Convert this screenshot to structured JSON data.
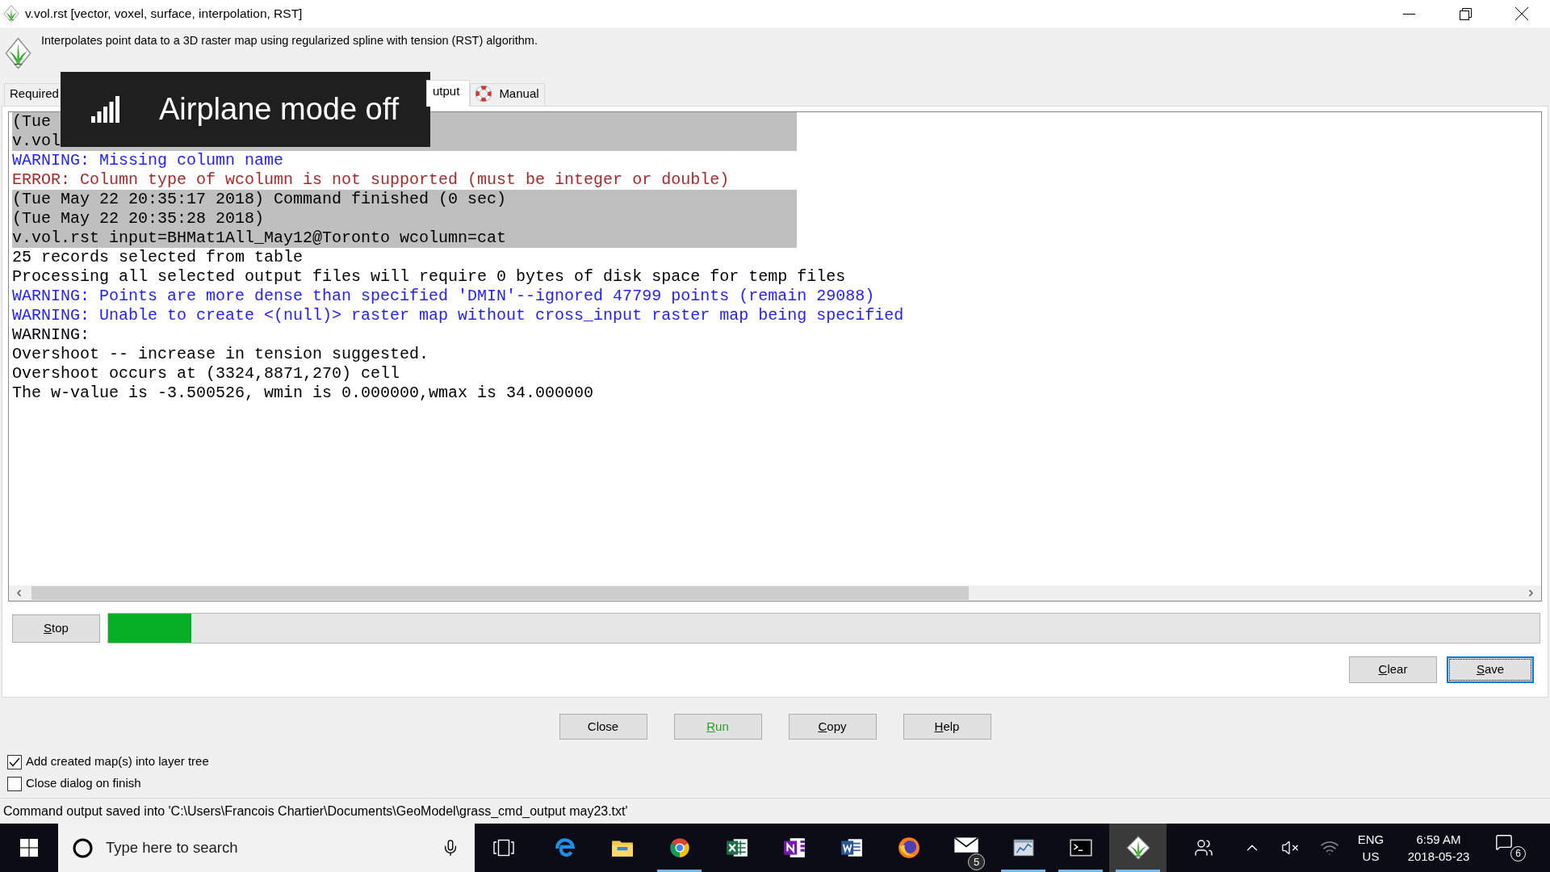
{
  "window": {
    "title": "v.vol.rst [vector, voxel, surface, interpolation, RST]"
  },
  "description": "Interpolates point data to a 3D raster map using regularized spline with tension (RST) algorithm.",
  "tabs": [
    {
      "label": "Required",
      "selected": false,
      "kind": "page"
    },
    {
      "label": "utput",
      "selected": true,
      "kind": "page"
    },
    {
      "label": "Manual",
      "selected": false,
      "kind": "manual"
    }
  ],
  "console": {
    "lines": [
      {
        "text": "(Tue",
        "kind": "command"
      },
      {
        "text": "v.vol",
        "kind": "command"
      },
      {
        "text": "WARNING: Missing column name",
        "kind": "warning"
      },
      {
        "text": "ERROR: Column type of wcolumn is not supported (must be integer or double)",
        "kind": "error"
      },
      {
        "text": "(Tue May 22 20:35:17 2018) Command finished (0 sec)",
        "kind": "command"
      },
      {
        "text": "(Tue May 22 20:35:28 2018)",
        "kind": "command"
      },
      {
        "text": "v.vol.rst input=BHMat1All_May12@Toronto wcolumn=cat",
        "kind": "command"
      },
      {
        "text": "25 records selected from table",
        "kind": "message"
      },
      {
        "text": "Processing all selected output files will require 0 bytes of disk space for temp files",
        "kind": "message"
      },
      {
        "text": "WARNING: Points are more dense than specified 'DMIN'--ignored 47799 points (remain 29088)",
        "kind": "warning"
      },
      {
        "text": "WARNING: Unable to create <(null)> raster map without cross_input raster map being specified",
        "kind": "warning"
      },
      {
        "text": "WARNING:",
        "kind": "message"
      },
      {
        "text": "Overshoot -- increase in tension suggested.",
        "kind": "message"
      },
      {
        "text": "Overshoot occurs at (3324,8871,270) cell",
        "kind": "message"
      },
      {
        "text": "The w-value is -3.500526, wmin is 0.000000,wmax is 34.000000",
        "kind": "message"
      }
    ]
  },
  "stop_button": {
    "label": "Stop",
    "mnemonic": true
  },
  "progress": {
    "level": 0.058
  },
  "console_buttons": [
    {
      "label": "Clear",
      "mnemonic": true,
      "focused": false
    },
    {
      "label": "Save",
      "mnemonic": true,
      "focused": true
    }
  ],
  "buttons": [
    {
      "label": "Close",
      "mnemonic": false,
      "kind": "plain"
    },
    {
      "label": "Run",
      "mnemonic": true,
      "kind": "run"
    },
    {
      "label": "Copy",
      "mnemonic": true,
      "kind": "plain"
    },
    {
      "label": "Help",
      "mnemonic": true,
      "kind": "plain"
    }
  ],
  "options": [
    {
      "label": "Add created map(s) into layer tree",
      "checked": true
    },
    {
      "label": "Close dialog on finish",
      "checked": false
    }
  ],
  "status_bar": "Command output saved into 'C:\\Users\\Francois Chartier\\Documents\\GeoModel\\grass_cmd_output may23.txt'",
  "notification": {
    "message": "Airplane mode off"
  },
  "taskbar": {
    "search": {
      "placeholder": "Type here to search"
    },
    "apps": [
      {
        "running": false,
        "active": false
      },
      {
        "running": false,
        "active": false
      },
      {
        "running": true,
        "active": false
      },
      {
        "running": false,
        "active": false
      },
      {
        "running": false,
        "active": false
      },
      {
        "running": false,
        "active": false
      },
      {
        "running": false,
        "active": false
      },
      {
        "running": false,
        "active": false,
        "badge": "5"
      },
      {
        "running": true,
        "active": false
      },
      {
        "running": true,
        "active": false
      },
      {
        "running": true,
        "active": true
      }
    ],
    "tray": {
      "language": [
        "ENG",
        "US"
      ],
      "clock": {
        "time": "6:59 AM",
        "date": "2018-05-23"
      },
      "notification_count": "6"
    }
  }
}
